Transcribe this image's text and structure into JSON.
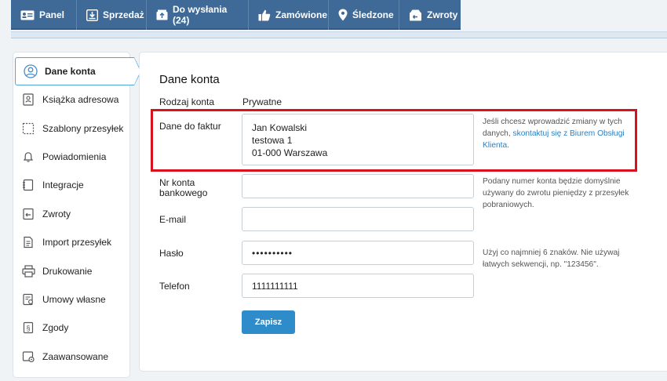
{
  "nav": {
    "tabs": [
      {
        "label": "Panel",
        "icon": "id-card-icon"
      },
      {
        "label": "Sprzedaż",
        "icon": "download-icon"
      },
      {
        "label": "Do wysłania (24)",
        "icon": "package-icon"
      },
      {
        "label": "Zamówione",
        "icon": "thumb-up-icon"
      },
      {
        "label": "Śledzone",
        "icon": "location-pin-icon"
      },
      {
        "label": "Zwroty",
        "icon": "return-box-icon"
      }
    ]
  },
  "sidebar": {
    "items": [
      {
        "label": "Dane konta",
        "icon": "user-circle-icon",
        "active": true
      },
      {
        "label": "Książka adresowa",
        "icon": "address-book-icon"
      },
      {
        "label": "Szablony przesyłek",
        "icon": "template-icon"
      },
      {
        "label": "Powiadomienia",
        "icon": "bell-icon"
      },
      {
        "label": "Integracje",
        "icon": "integration-icon"
      },
      {
        "label": "Zwroty",
        "icon": "return-icon"
      },
      {
        "label": "Import przesyłek",
        "icon": "import-icon"
      },
      {
        "label": "Drukowanie",
        "icon": "printer-icon"
      },
      {
        "label": "Umowy własne",
        "icon": "contract-icon"
      },
      {
        "label": "Zgody",
        "icon": "consent-icon"
      },
      {
        "label": "Zaawansowane",
        "icon": "advanced-icon"
      }
    ]
  },
  "main": {
    "title": "Dane konta",
    "account_type_label": "Rodzaj konta",
    "account_type_value": "Prywatne",
    "invoice_label": "Dane do faktur",
    "invoice_lines": [
      "Jan Kowalski",
      "testowa 1",
      "01-000 Warszawa"
    ],
    "invoice_hint_prefix": "Jeśli chcesz wprowadzić zmiany w tych danych, ",
    "invoice_hint_link": "skontaktuj się z Biurem Obsługi Klienta",
    "invoice_hint_suffix": ".",
    "bank_label_1": "Nr konta",
    "bank_label_2": "bankowego",
    "bank_value": "",
    "bank_hint": "Podany numer konta będzie domyślnie używany do zwrotu pieniędzy z przesyłek pobraniowych.",
    "email_label": "E-mail",
    "email_value": "",
    "password_label": "Hasło",
    "password_value": "••••••••••",
    "password_hint": "Użyj co najmniej 6 znaków. Nie używaj łatwych sekwencji, np. \"123456\".",
    "phone_label": "Telefon",
    "phone_value": "1111111111",
    "save_label": "Zapisz"
  },
  "colors": {
    "nav_bg": "#3f6a97",
    "accent": "#2f8ccb",
    "highlight": "#d9131e",
    "link": "#2a7fc1"
  }
}
